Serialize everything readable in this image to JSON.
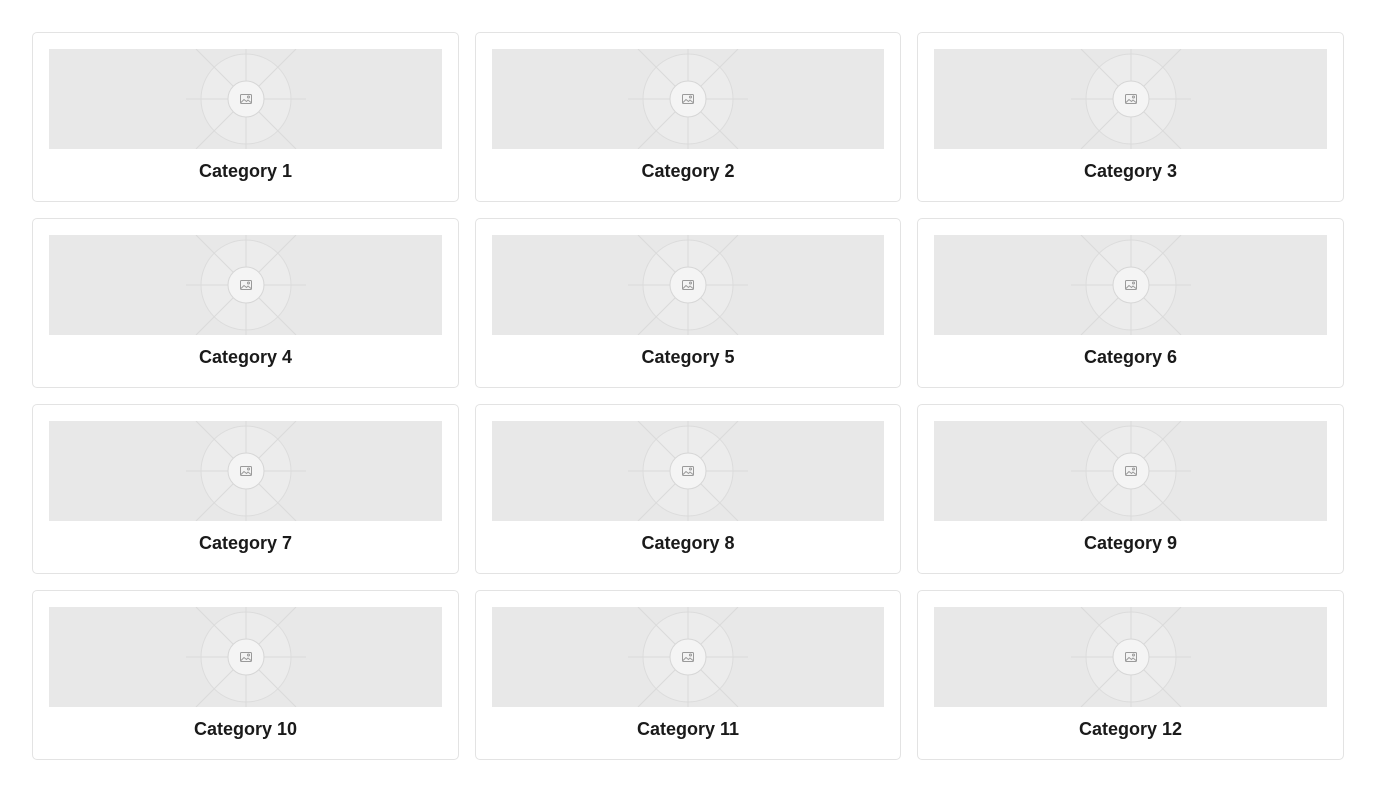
{
  "categories": [
    {
      "label": "Category 1"
    },
    {
      "label": "Category 2"
    },
    {
      "label": "Category 3"
    },
    {
      "label": "Category 4"
    },
    {
      "label": "Category 5"
    },
    {
      "label": "Category 6"
    },
    {
      "label": "Category 7"
    },
    {
      "label": "Category 8"
    },
    {
      "label": "Category 9"
    },
    {
      "label": "Category 10"
    },
    {
      "label": "Category 11"
    },
    {
      "label": "Category 12"
    }
  ],
  "placeholder_icon": "image-placeholder-icon",
  "colors": {
    "background": "#ffffff",
    "card_border": "#e3e3e3",
    "thumb_background": "#e8e8e8",
    "label_text": "#1a1a1a"
  }
}
